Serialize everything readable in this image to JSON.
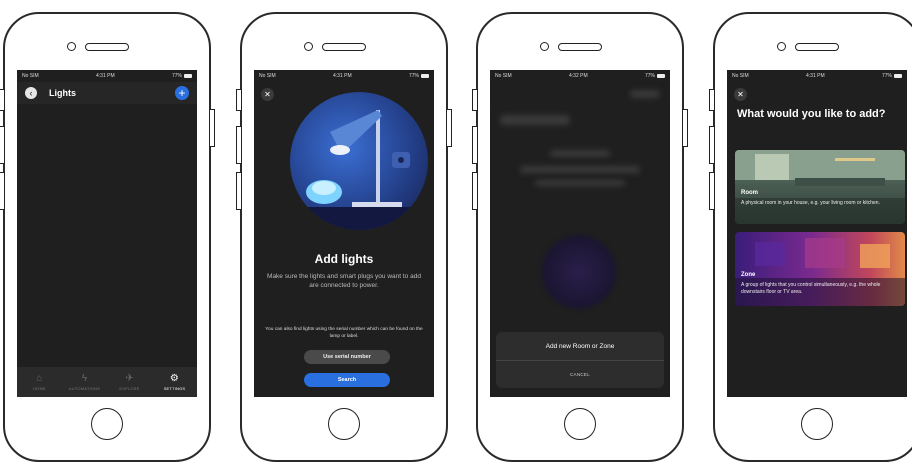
{
  "status_bar": {
    "screen1": {
      "carrier": "No SIM",
      "time": "4:31 PM",
      "battery": "77%"
    },
    "screen2": {
      "carrier": "No SIM",
      "time": "4:31 PM",
      "battery": "77%"
    },
    "screen3": {
      "carrier": "No SIM",
      "time": "4:32 PM",
      "battery": "77%"
    },
    "screen4": {
      "carrier": "No SIM",
      "time": "4:31 PM",
      "battery": "77%"
    }
  },
  "screen1": {
    "back_icon": "‹",
    "title": "Lights",
    "add_icon": "+",
    "tabs": [
      {
        "icon": "⌂",
        "label": "HOME"
      },
      {
        "icon": "ϟ",
        "label": "AUTOMATIONS"
      },
      {
        "icon": "✈",
        "label": "EXPLORE"
      },
      {
        "icon": "⚙",
        "label": "SETTINGS"
      }
    ]
  },
  "screen2": {
    "close_icon": "✕",
    "title": "Add lights",
    "subtitle": "Make sure the lights and smart plugs you want to add are connected to power.",
    "note": "You can also find lights using the serial number which can be found on the lamp or label.",
    "serial_button": "Use serial number",
    "search_button": "Search"
  },
  "screen3": {
    "sheet_title": "Add new Room or Zone",
    "cancel": "CANCEL"
  },
  "screen4": {
    "close_icon": "✕",
    "title": "What would you like to add?",
    "room": {
      "label": "Room",
      "description": "A physical room in your house, e.g. your living room or kitchen."
    },
    "zone": {
      "label": "Zone",
      "description": "A group of lights that you control simultaneously, e.g. the whole downstairs floor or TV area."
    }
  },
  "colors": {
    "accent": "#2a6fe0",
    "screen_bg": "#1f1f1f"
  }
}
